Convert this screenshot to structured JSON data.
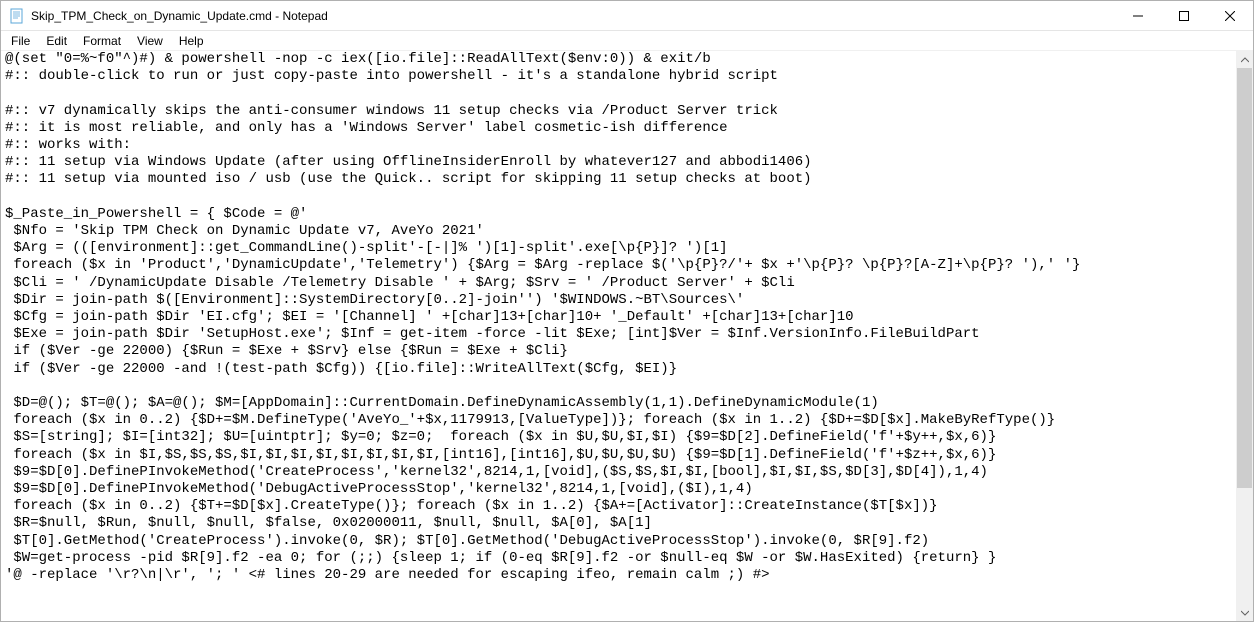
{
  "window": {
    "title": "Skip_TPM_Check_on_Dynamic_Update.cmd - Notepad"
  },
  "menu": {
    "file": "File",
    "edit": "Edit",
    "format": "Format",
    "view": "View",
    "help": "Help"
  },
  "content": "@(set \"0=%~f0\"^)#) & powershell -nop -c iex([io.file]::ReadAllText($env:0)) & exit/b\n#:: double-click to run or just copy-paste into powershell - it's a standalone hybrid script\n\n#:: v7 dynamically skips the anti-consumer windows 11 setup checks via /Product Server trick\n#:: it is most reliable, and only has a 'Windows Server' label cosmetic-ish difference\n#:: works with:\n#:: 11 setup via Windows Update (after using OfflineInsiderEnroll by whatever127 and abbodi1406)\n#:: 11 setup via mounted iso / usb (use the Quick.. script for skipping 11 setup checks at boot)\n\n$_Paste_in_Powershell = { $Code = @'\n $Nfo = 'Skip TPM Check on Dynamic Update v7, AveYo 2021'\n $Arg = (([environment]::get_CommandLine()-split'-[-|]% ')[1]-split'.exe[\\p{P}]? ')[1]\n foreach ($x in 'Product','DynamicUpdate','Telemetry') {$Arg = $Arg -replace $('\\p{P}?/'+ $x +'\\p{P}? \\p{P}?[A-Z]+\\p{P}? '),' '}\n $Cli = ' /DynamicUpdate Disable /Telemetry Disable ' + $Arg; $Srv = ' /Product Server' + $Cli\n $Dir = join-path $([Environment]::SystemDirectory[0..2]-join'') '$WINDOWS.~BT\\Sources\\'\n $Cfg = join-path $Dir 'EI.cfg'; $EI = '[Channel] ' +[char]13+[char]10+ '_Default' +[char]13+[char]10\n $Exe = join-path $Dir 'SetupHost.exe'; $Inf = get-item -force -lit $Exe; [int]$Ver = $Inf.VersionInfo.FileBuildPart\n if ($Ver -ge 22000) {$Run = $Exe + $Srv} else {$Run = $Exe + $Cli}\n if ($Ver -ge 22000 -and !(test-path $Cfg)) {[io.file]::WriteAllText($Cfg, $EI)}\n\n $D=@(); $T=@(); $A=@(); $M=[AppDomain]::CurrentDomain.DefineDynamicAssembly(1,1).DefineDynamicModule(1)\n foreach ($x in 0..2) {$D+=$M.DefineType('AveYo_'+$x,1179913,[ValueType])}; foreach ($x in 1..2) {$D+=$D[$x].MakeByRefType()}\n $S=[string]; $I=[int32]; $U=[uintptr]; $y=0; $z=0;  foreach ($x in $U,$U,$I,$I) {$9=$D[2].DefineField('f'+$y++,$x,6)}\n foreach ($x in $I,$S,$S,$S,$I,$I,$I,$I,$I,$I,$I,$I,[int16],[int16],$U,$U,$U,$U) {$9=$D[1].DefineField('f'+$z++,$x,6)}\n $9=$D[0].DefinePInvokeMethod('CreateProcess','kernel32',8214,1,[void],($S,$S,$I,$I,[bool],$I,$I,$S,$D[3],$D[4]),1,4)\n $9=$D[0].DefinePInvokeMethod('DebugActiveProcessStop','kernel32',8214,1,[void],($I),1,4)\n foreach ($x in 0..2) {$T+=$D[$x].CreateType()}; foreach ($x in 1..2) {$A+=[Activator]::CreateInstance($T[$x])}\n $R=$null, $Run, $null, $null, $false, 0x02000011, $null, $null, $A[0], $A[1]\n $T[0].GetMethod('CreateProcess').invoke(0, $R); $T[0].GetMethod('DebugActiveProcessStop').invoke(0, $R[9].f2)\n $W=get-process -pid $R[9].f2 -ea 0; for (;;) {sleep 1; if (0-eq $R[9].f2 -or $null-eq $W -or $W.HasExited) {return} }\n'@ -replace '\\r?\\n|\\r', '; ' <# lines 20-29 are needed for escaping ifeo, remain calm ;) #>"
}
